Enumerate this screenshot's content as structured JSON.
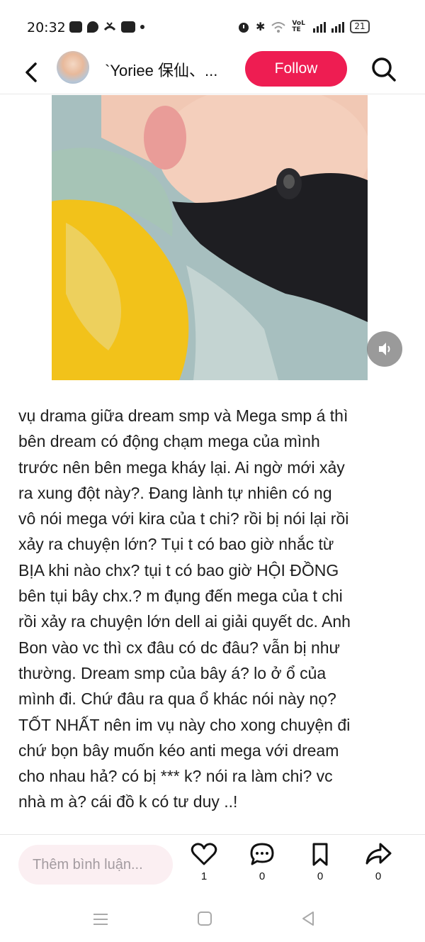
{
  "status_bar": {
    "time": "20:32",
    "battery": "21",
    "network": "VoLTE"
  },
  "header": {
    "title": "`Yoriee 保仙、...",
    "follow_label": "Follow"
  },
  "post": {
    "text": "vụ drama giữa dream smp và Mega smp á thì\nbên dream có động chạm mega của mình\ntrước nên bên mega kháy lại. Ai ngờ mới xảy\nra xung đột này?. Đang lành tự nhiên có ng\nvô nói mega với kira của t chi? rồi bị nói lại rồi\nxảy ra chuyện lớn? Tụi t có bao giờ nhắc từ\nBỊA khi nào chx? tụi t có bao giờ HỘI ĐỒNG\nbên tụi bây chx.? m đụng đến mega của t chi\nrồi xảy ra chuyện lớn dell ai giải quyết dc. Anh\nBon vào vc thì cx đâu có dc đâu? vẫn bị như\nthường. Dream smp của bây á? lo ở ổ của\nmình đi. Chứ đâu ra qua ổ khác nói này nọ?\nTỐT NHẤT nên im vụ này cho xong chuyện đi\nchứ bọn bây muốn kéo anti mega với dream\ncho nhau hả? có bị *** k? nói ra làm chi? vc\nnhà m à? cái đồ k có tư duy ..!"
  },
  "actions": {
    "comment_placeholder": "Thêm bình luận...",
    "likes": "1",
    "comments": "0",
    "saves": "0",
    "shares": "0"
  },
  "icons": {
    "back": "back-arrow-icon",
    "search": "search-icon",
    "mute": "volume-icon",
    "like": "heart-icon",
    "comment": "comment-icon",
    "save": "bookmark-icon",
    "share": "share-icon"
  },
  "colors": {
    "follow_bg": "#ee1d52",
    "comment_bg": "#fbeff2"
  }
}
